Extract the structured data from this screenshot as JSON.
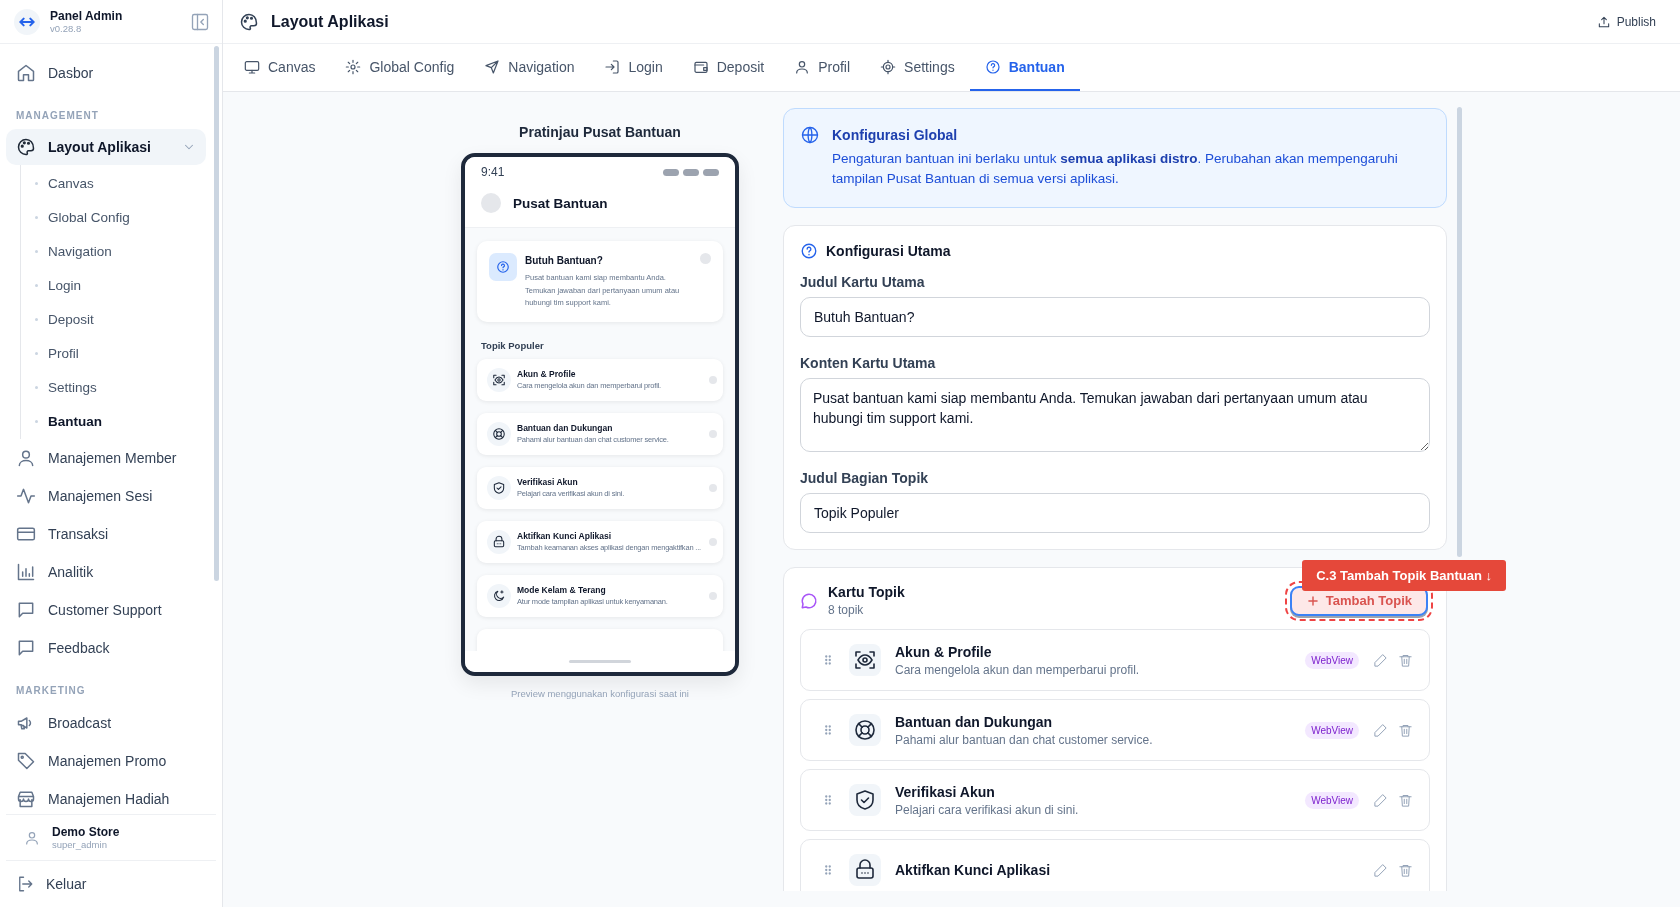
{
  "sidebar": {
    "brand": {
      "title": "Panel Admin",
      "version": "v0.28.8"
    },
    "items": [
      {
        "kind": "item",
        "label": "Dasbor",
        "selected": false
      },
      {
        "kind": "section",
        "label": "MANAGEMENT"
      },
      {
        "kind": "group",
        "label": "Layout Aplikasi",
        "selected": true,
        "expanded": true,
        "children": [
          {
            "label": "Canvas",
            "selected": false
          },
          {
            "label": "Global Config",
            "selected": false
          },
          {
            "label": "Navigation",
            "selected": false
          },
          {
            "label": "Login",
            "selected": false
          },
          {
            "label": "Deposit",
            "selected": false
          },
          {
            "label": "Profil",
            "selected": false
          },
          {
            "label": "Settings",
            "selected": false
          },
          {
            "label": "Bantuan",
            "selected": true
          }
        ]
      },
      {
        "kind": "item",
        "label": "Manajemen Member",
        "selected": false
      },
      {
        "kind": "item",
        "label": "Manajemen Sesi",
        "selected": false
      },
      {
        "kind": "item",
        "label": "Transaksi",
        "selected": false
      },
      {
        "kind": "item",
        "label": "Analitik",
        "selected": false
      },
      {
        "kind": "item",
        "label": "Customer Support",
        "selected": false
      },
      {
        "kind": "item",
        "label": "Feedback",
        "selected": false
      },
      {
        "kind": "section",
        "label": "MARKETING"
      },
      {
        "kind": "item",
        "label": "Broadcast",
        "selected": false
      },
      {
        "kind": "item",
        "label": "Manajemen Promo",
        "selected": false
      },
      {
        "kind": "item",
        "label": "Manajemen Hadiah",
        "selected": false
      }
    ],
    "user": {
      "name": "Demo Store",
      "role": "super_admin"
    },
    "logout": "Keluar"
  },
  "header": {
    "title": "Layout Aplikasi",
    "publish": "Publish"
  },
  "tabs": [
    {
      "label": "Canvas",
      "selected": false
    },
    {
      "label": "Global Config",
      "selected": false
    },
    {
      "label": "Navigation",
      "selected": false
    },
    {
      "label": "Login",
      "selected": false
    },
    {
      "label": "Deposit",
      "selected": false
    },
    {
      "label": "Profil",
      "selected": false
    },
    {
      "label": "Settings",
      "selected": false
    },
    {
      "label": "Bantuan",
      "selected": true
    }
  ],
  "preview": {
    "title": "Pratinjau Pusat Bantuan",
    "time": "9:41",
    "screen_title": "Pusat Bantuan",
    "help_card": {
      "title": "Butuh Bantuan?",
      "text": "Pusat bantuan kami siap membantu Anda. Temukan jawaban dari pertanyaan umum atau hubungi tim support kami."
    },
    "section_title": "Topik Populer",
    "topics": [
      {
        "title": "Akun & Profile",
        "text": "Cara mengelola akun dan memperbarui profil."
      },
      {
        "title": "Bantuan dan Dukungan",
        "text": "Pahami alur bantuan dan chat customer service."
      },
      {
        "title": "Verifikasi Akun",
        "text": "Pelajari cara verifikasi akun di sini."
      },
      {
        "title": "Aktifkan Kunci Aplikasi",
        "text": "Tambah keamanan akses aplikasi dengan mengaktifkan ..."
      },
      {
        "title": "Mode Kelam & Terang",
        "text": "Atur mode tampilan aplikasi untuk kenyamanan."
      }
    ],
    "caption": "Preview menggunakan konfigurasi saat ini"
  },
  "global_notice": {
    "title": "Konfigurasi Global",
    "text": "Pengaturan bantuan ini berlaku untuk **semua aplikasi distro**. Perubahan akan mempengaruhi tampilan Pusat Bantuan di semua versi aplikasi."
  },
  "main_config": {
    "title": "Konfigurasi Utama",
    "fields": [
      {
        "kind": "input",
        "label": "Judul Kartu Utama",
        "value": "Butuh Bantuan?"
      },
      {
        "kind": "textarea",
        "label": "Konten Kartu Utama",
        "value": "Pusat bantuan kami siap membantu Anda. Temukan jawaban dari pertanyaan umum atau hubungi tim support kami."
      },
      {
        "kind": "input",
        "label": "Judul Bagian Topik",
        "value": "Topik Populer"
      }
    ]
  },
  "topic_cards": {
    "title": "Kartu Topik",
    "count": "8 topik",
    "add_button": "Tambah Topik",
    "topics": [
      {
        "title": "Akun & Profile",
        "text": "Cara mengelola akun dan memperbarui profil.",
        "badge": "WebView"
      },
      {
        "title": "Bantuan dan Dukungan",
        "text": "Pahami alur bantuan dan chat customer service.",
        "badge": "WebView"
      },
      {
        "title": "Verifikasi Akun",
        "text": "Pelajari cara verifikasi akun di sini.",
        "badge": "WebView"
      },
      {
        "title": "Aktifkan Kunci Aplikasi"
      }
    ]
  },
  "annotation": {
    "label": "C.3 Tambah Topik Bantuan ↓"
  }
}
